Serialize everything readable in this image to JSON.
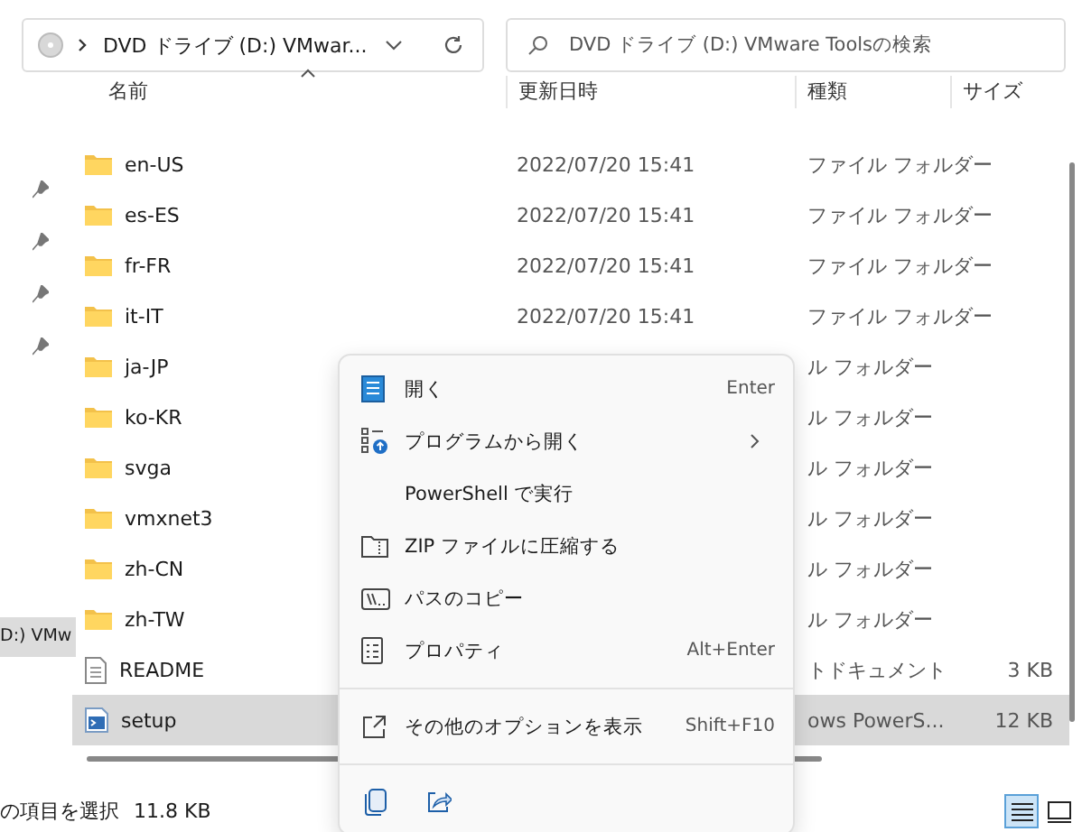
{
  "address_bar": {
    "path": "DVD ドライブ (D:) VMwar..."
  },
  "search": {
    "placeholder": "DVD ドライブ (D:) VMware Toolsの検索"
  },
  "nav_pane": {
    "items": [
      {
        "label": "D:) VMw",
        "selected": true
      }
    ]
  },
  "table": {
    "columns": [
      "名前",
      "更新日時",
      "種類",
      "サイズ"
    ],
    "rows": [
      {
        "kind": "folder",
        "name": "en-US",
        "date": "2022/07/20 15:41",
        "type": "ファイル フォルダー",
        "selected": false
      },
      {
        "kind": "folder",
        "name": "es-ES",
        "date": "2022/07/20 15:41",
        "type": "ファイル フォルダー",
        "selected": false
      },
      {
        "kind": "folder",
        "name": "fr-FR",
        "date": "2022/07/20 15:41",
        "type": "ファイル フォルダー",
        "selected": false
      },
      {
        "kind": "folder",
        "name": "it-IT",
        "date": "2022/07/20 15:41",
        "type": "ファイル フォルダー",
        "selected": false
      },
      {
        "kind": "folder",
        "name": "ja-JP",
        "type": "ル フォルダー",
        "selected": false
      },
      {
        "kind": "folder",
        "name": "ko-KR",
        "type": "ル フォルダー",
        "selected": false
      },
      {
        "kind": "folder",
        "name": "svga",
        "type": "ル フォルダー",
        "selected": false
      },
      {
        "kind": "folder",
        "name": "vmxnet3",
        "type": "ル フォルダー",
        "selected": false
      },
      {
        "kind": "folder",
        "name": "zh-CN",
        "type": "ル フォルダー",
        "selected": false
      },
      {
        "kind": "folder",
        "name": "zh-TW",
        "type": "ル フォルダー",
        "selected": false
      },
      {
        "kind": "text",
        "name": "README",
        "type": "トドキュメント",
        "size": "3 KB",
        "selected": false
      },
      {
        "kind": "script",
        "name": "setup",
        "type": "ows PowerS...",
        "size": "12 KB",
        "selected": true
      }
    ]
  },
  "context_menu": {
    "items": [
      {
        "label": "開く",
        "shortcut": "Enter"
      },
      {
        "label": "プログラムから開く",
        "submenu": true
      },
      {
        "label": "PowerShell で実行"
      },
      {
        "label": "ZIP ファイルに圧縮する"
      },
      {
        "label": "パスのコピー"
      },
      {
        "label": "プロパティ",
        "shortcut": "Alt+Enter"
      },
      {
        "label": "その他のオプションを表示",
        "shortcut": "Shift+F10",
        "separator_before": true
      }
    ]
  },
  "status_bar": {
    "text": "の項目を選択",
    "size": "11.8 KB"
  },
  "view_buttons": [
    {
      "kind": "details",
      "selected": true
    },
    {
      "kind": "tiles",
      "selected": false
    }
  ]
}
